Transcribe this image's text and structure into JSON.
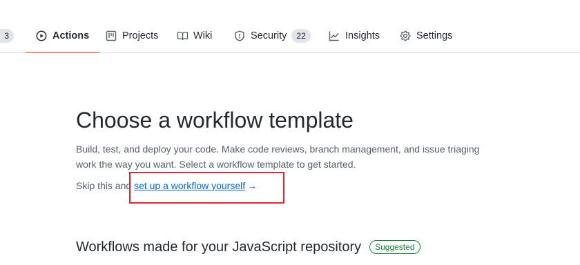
{
  "nav": {
    "partial_counter": "3",
    "tabs": [
      {
        "label": "Actions",
        "icon": "play-circle-icon"
      },
      {
        "label": "Projects",
        "icon": "project-board-icon"
      },
      {
        "label": "Wiki",
        "icon": "book-icon"
      },
      {
        "label": "Security",
        "icon": "shield-icon",
        "counter": "22"
      },
      {
        "label": "Insights",
        "icon": "graph-icon"
      },
      {
        "label": "Settings",
        "icon": "gear-icon"
      }
    ],
    "active_tab": "Actions"
  },
  "main": {
    "title": "Choose a workflow template",
    "description": "Build, test, and deploy your code. Make code reviews, branch management, and issue triaging work the way you want. Select a workflow template to get started.",
    "skip_prefix": "Skip this and ",
    "skip_link": "set up a workflow yourself",
    "skip_arrow": "→",
    "section_title": "Workflows made for your JavaScript repository",
    "section_badge": "Suggested"
  },
  "colors": {
    "accent_underline": "#fd8c73",
    "link": "#0969da",
    "highlight_box": "#e0262d",
    "badge": "#1a7f37"
  }
}
